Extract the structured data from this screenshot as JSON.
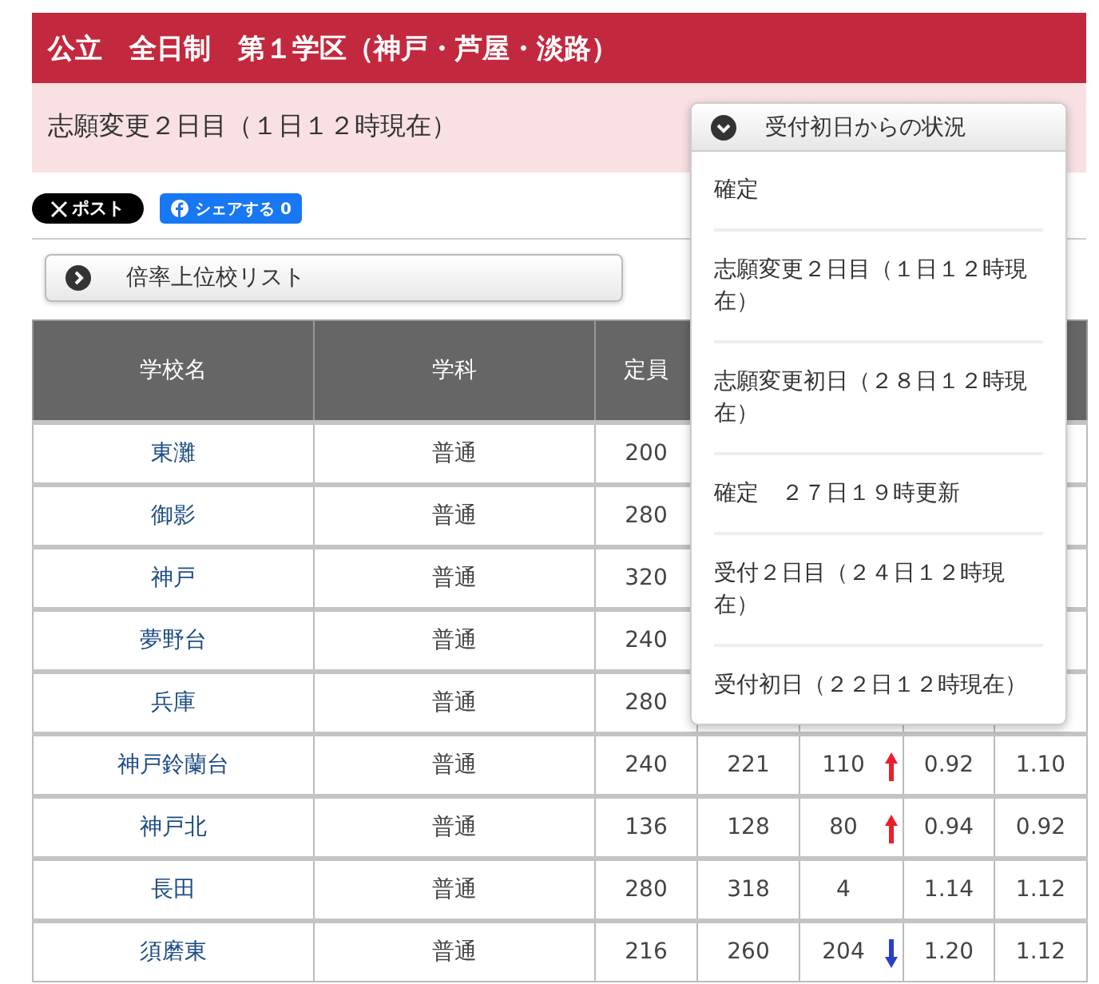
{
  "header": {
    "title": "公立　全日制　第１学区（神戸・芦屋・淡路）"
  },
  "status_bar": {
    "text": "志願変更２日目（１日１２時現在）"
  },
  "dropdown": {
    "label": "受付初日からの状況",
    "expanded": true,
    "items": [
      {
        "label": "確定"
      },
      {
        "label": "志願変更２日目（１日１２時現在）"
      },
      {
        "label": "志願変更初日（２８日１２時現在）"
      },
      {
        "label": "確定　２７日１９時更新"
      },
      {
        "label": "受付２日目（２４日１２時現在）"
      },
      {
        "label": "受付初日（２２日１２時現在）"
      }
    ]
  },
  "share": {
    "x_button": "ポスト",
    "fb_button": "シェアする",
    "fb_count": "0"
  },
  "ranking_button": {
    "label": "倍率上位校リスト"
  },
  "table": {
    "columns": [
      "学校名",
      "学科",
      "定員"
    ],
    "rows": [
      {
        "school": "東灘",
        "dept": "普通",
        "capacity": "200"
      },
      {
        "school": "御影",
        "dept": "普通",
        "capacity": "280"
      },
      {
        "school": "神戸",
        "dept": "普通",
        "capacity": "320"
      },
      {
        "school": "夢野台",
        "dept": "普通",
        "capacity": "240"
      },
      {
        "school": "兵庫",
        "dept": "普通",
        "capacity": "280"
      },
      {
        "school": "神戸鈴蘭台",
        "dept": "普通",
        "capacity": "240",
        "applicants": "221",
        "change": "110",
        "rising": true,
        "falling": false,
        "ratio": "0.92",
        "prev_ratio": "1.10"
      },
      {
        "school": "神戸北",
        "dept": "普通",
        "capacity": "136",
        "applicants": "128",
        "change": "80",
        "rising": true,
        "falling": false,
        "ratio": "0.94",
        "prev_ratio": "0.92"
      },
      {
        "school": "長田",
        "dept": "普通",
        "capacity": "280",
        "applicants": "318",
        "change": "4",
        "rising": false,
        "falling": false,
        "ratio": "1.14",
        "prev_ratio": "1.12"
      },
      {
        "school": "須磨東",
        "dept": "普通",
        "capacity": "216",
        "applicants": "260",
        "change": "204",
        "rising": false,
        "falling": true,
        "ratio": "1.20",
        "prev_ratio": "1.12"
      }
    ]
  }
}
